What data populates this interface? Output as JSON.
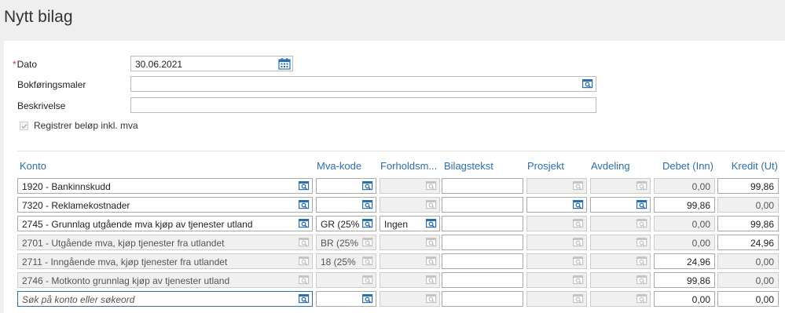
{
  "page": {
    "title": "Nytt bilag"
  },
  "form": {
    "dato_label": "Dato",
    "dato_required_mark": "*",
    "dato_value": "30.06.2021",
    "bokforingsmaler_label": "Bokføringsmaler",
    "bokforingsmaler_value": "",
    "beskrivelse_label": "Beskrivelse",
    "beskrivelse_value": "",
    "registrer_label": "Registrer beløp inkl. mva",
    "registrer_checked": true
  },
  "table": {
    "headers": {
      "konto": "Konto",
      "mva": "Mva-kode",
      "forhold": "Forholdsm...",
      "bilagstekst": "Bilagstekst",
      "prosjekt": "Prosjekt",
      "avdeling": "Avdeling",
      "debet": "Debet (Inn)",
      "kredit": "Kredit (Ut)"
    },
    "rows": [
      {
        "konto": "1920 - Bankinnskudd",
        "mva": "",
        "forhold": "",
        "debet": "0,00",
        "kredit": "99,86"
      },
      {
        "konto": "7320 - Reklamekostnader",
        "mva": "",
        "forhold": "",
        "debet": "99,86",
        "kredit": "0,00"
      },
      {
        "konto": "2745 - Grunnlag utgående mva kjøp av tjenester utland",
        "mva": "GR (25%",
        "forhold": "Ingen",
        "debet": "0,00",
        "kredit": "99,86"
      },
      {
        "konto": "2701 - Utgående mva, kjøp tjenester fra utlandet",
        "mva": "BR (25%",
        "forhold": "",
        "debet": "0,00",
        "kredit": "24,96"
      },
      {
        "konto": "2711 - Inngående mva, kjøp tjenester fra utlandet",
        "mva": "18 (25%",
        "forhold": "",
        "debet": "24,96",
        "kredit": "0,00"
      },
      {
        "konto": "2746 - Motkonto grunnlag kjøp av tjenester utland",
        "mva": "",
        "forhold": "",
        "debet": "99,86",
        "kredit": "0,00"
      }
    ],
    "new_row": {
      "konto_placeholder": "Søk på konto eller søkeord",
      "debet": "0,00",
      "kredit": "0,00"
    }
  },
  "icons": {
    "lookup": "lookup-icon",
    "calendar": "calendar-icon",
    "checkbox": "checkmark-icon"
  },
  "colors": {
    "accent": "#2a6fb0",
    "header_text": "#2a6fb0",
    "disabled_bg": "#f0f0f0",
    "required": "#cc3333"
  }
}
